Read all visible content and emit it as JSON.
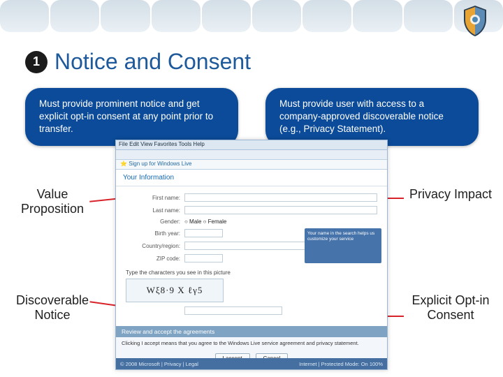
{
  "number": "1",
  "title": "Notice and Consent",
  "bubble_left": "Must provide prominent notice and get explicit opt-in consent at any point prior to transfer.",
  "bubble_right": "Must provide user with access to a company-approved discoverable notice (e.g., Privacy Statement).",
  "labels": {
    "value_proposition": "Value Proposition",
    "privacy_impact": "Privacy Impact",
    "discoverable_notice": "Discoverable Notice",
    "explicit_optin": "Explicit Opt-in Consent"
  },
  "window": {
    "menu": "File   Edit   View   Favorites   Tools   Help",
    "tab": "Sign up for Windows Live",
    "section_heading": "Your Information",
    "form": {
      "first_name": "First name:",
      "last_name": "Last name:",
      "gender": "Gender:",
      "gender_opts": "○ Male   ○ Female",
      "birth_year": "Birth year:",
      "country": "Country/region:",
      "zip": "ZIP code:"
    },
    "bluebox": "Your name in the search helps us customize your service",
    "captcha_prompt": "Type the characters you see in this picture",
    "captcha_text": "Wξ8·9 X ℓγ5",
    "agree_heading": "Review and accept the agreements",
    "agree_note": "Clicking I accept means that you agree to the Windows Live service agreement and privacy statement.",
    "btn_accept": "I accept",
    "btn_cancel": "Cancel",
    "footer_left": "© 2008 Microsoft   |   Privacy   |   Legal",
    "footer_right": "Internet | Protected Mode: On        100%"
  }
}
